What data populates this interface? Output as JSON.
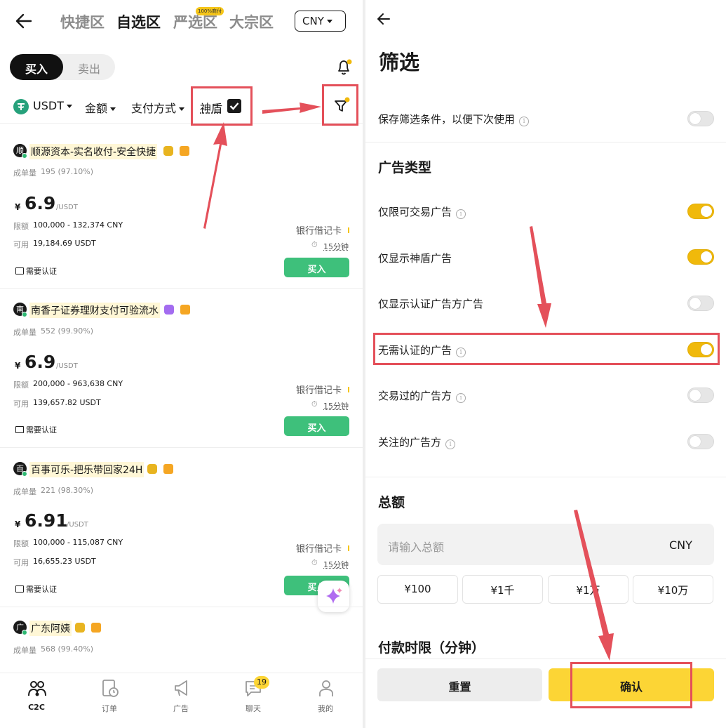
{
  "left": {
    "tabs": [
      {
        "label": "快捷区"
      },
      {
        "label": "自选区"
      },
      {
        "label": "严选区",
        "badge": "100%商付"
      },
      {
        "label": "大宗区"
      }
    ],
    "currency": "CNY",
    "side": {
      "buy": "买入",
      "sell": "卖出"
    },
    "filters": {
      "asset": "USDT",
      "amount": "金额",
      "payment": "支付方式",
      "shield": "神盾"
    },
    "listings": [
      {
        "avatar": "顺",
        "name": "顺源资本-实名收付-安全快捷",
        "volume_label": "成单量",
        "volume": "195 (97.10%)",
        "currency_symbol": "¥",
        "price": "6.9",
        "unit": "/USDT",
        "limit_label": "限额",
        "limit": "100,000 - 132,374 CNY",
        "avail_label": "可用",
        "avail": "19,184.69 USDT",
        "payment": "银行借记卡",
        "time": "15分钟",
        "kyc": "需要认证",
        "action": "买入"
      },
      {
        "avatar": "南",
        "name": "南香子证券理财支付可验流水",
        "volume_label": "成单量",
        "volume": "552 (99.90%)",
        "currency_symbol": "¥",
        "price": "6.9",
        "unit": "/USDT",
        "limit_label": "限额",
        "limit": "200,000 - 963,638 CNY",
        "avail_label": "可用",
        "avail": "139,657.82 USDT",
        "payment": "银行借记卡",
        "time": "15分钟",
        "kyc": "需要认证",
        "action": "买入"
      },
      {
        "avatar": "百",
        "name": "百事可乐-把乐带回家24H",
        "volume_label": "成单量",
        "volume": "221 (98.30%)",
        "currency_symbol": "¥",
        "price": "6.91",
        "unit": "/USDT",
        "limit_label": "限额",
        "limit": "100,000 - 115,087 CNY",
        "avail_label": "可用",
        "avail": "16,655.23 USDT",
        "payment": "银行借记卡",
        "time": "15分钟",
        "kyc": "需要认证",
        "action": "买入"
      },
      {
        "avatar": "广",
        "name": "广东阿姨",
        "volume_label": "成单量",
        "volume": "568 (99.40%)"
      }
    ],
    "nav": [
      {
        "label": "C2C",
        "icon": "people-icon"
      },
      {
        "label": "订单",
        "icon": "order-icon"
      },
      {
        "label": "广告",
        "icon": "megaphone-icon"
      },
      {
        "label": "聊天",
        "icon": "chat-icon",
        "badge": "19"
      },
      {
        "label": "我的",
        "icon": "user-icon"
      }
    ]
  },
  "right": {
    "title": "筛选",
    "save_label": "保存筛选条件，以便下次使用",
    "ad_type_title": "广告类型",
    "options": [
      {
        "label": "仅限可交易广告",
        "info": true,
        "on": true
      },
      {
        "label": "仅显示神盾广告",
        "info": false,
        "on": true
      },
      {
        "label": "仅显示认证广告方广告",
        "info": false,
        "on": false
      },
      {
        "label": "无需认证的广告",
        "info": true,
        "on": true
      },
      {
        "label": "交易过的广告方",
        "info": true,
        "on": false
      },
      {
        "label": "关注的广告方",
        "info": true,
        "on": false
      }
    ],
    "amount_title": "总额",
    "amount_placeholder": "请输入总额",
    "amount_currency": "CNY",
    "chips": [
      "¥100",
      "¥1千",
      "¥1万",
      "¥10万"
    ],
    "time_title": "付款时限（分钟）",
    "reset": "重置",
    "confirm": "确认"
  },
  "colors": {
    "accent_yellow": "#fcd535",
    "toggle_on": "#f0b90b",
    "buy_green": "#3ec07b",
    "annotation_red": "#e4505a"
  }
}
